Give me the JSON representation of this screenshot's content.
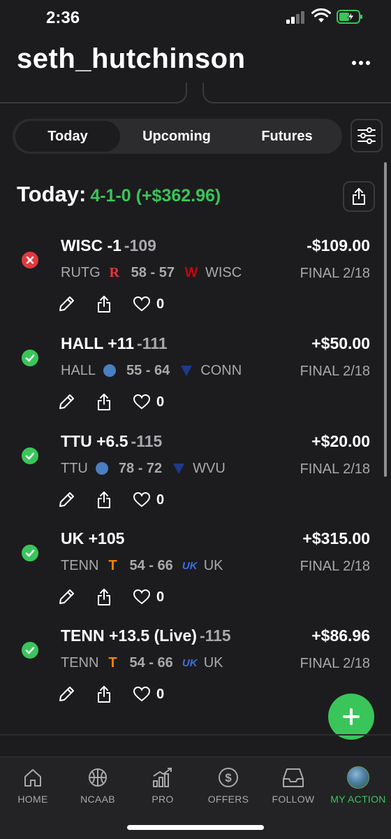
{
  "status": {
    "time": "2:36"
  },
  "header": {
    "username": "seth_hutchinson"
  },
  "tabs": [
    {
      "label": "Today",
      "active": true
    },
    {
      "label": "Upcoming",
      "active": false
    },
    {
      "label": "Futures",
      "active": false
    }
  ],
  "summary": {
    "label": "Today:",
    "record": "4-1-0 (+$362.96)"
  },
  "bets": [
    {
      "result": "loss",
      "pick": "WISC -1",
      "odds": "-109",
      "amount": "-$109.00",
      "away": "RUTG",
      "away_logo": "R",
      "score": "58 - 57",
      "home_logo": "W",
      "home": "WISC",
      "status": "FINAL 2/18",
      "likes": "0"
    },
    {
      "result": "win",
      "pick": "HALL +11",
      "odds": "-111",
      "amount": "+$50.00",
      "away": "HALL",
      "away_logo": "",
      "score": "55 - 64",
      "home_logo": "",
      "home": "CONN",
      "status": "FINAL 2/18",
      "likes": "0"
    },
    {
      "result": "win",
      "pick": "TTU +6.5",
      "odds": "-115",
      "amount": "+$20.00",
      "away": "TTU",
      "away_logo": "",
      "score": "78 - 72",
      "home_logo": "",
      "home": "WVU",
      "status": "FINAL 2/18",
      "likes": "0"
    },
    {
      "result": "win",
      "pick": "UK +105",
      "odds": "",
      "amount": "+$315.00",
      "away": "TENN",
      "away_logo": "T",
      "score": "54 - 66",
      "home_logo": "UK",
      "home": "UK",
      "status": "FINAL 2/18",
      "likes": "0"
    },
    {
      "result": "win",
      "pick": "TENN +13.5 (Live)",
      "odds": "-115",
      "amount": "+$86.96",
      "away": "TENN",
      "away_logo": "T",
      "score": "54 - 66",
      "home_logo": "UK",
      "home": "UK",
      "status": "FINAL 2/18",
      "likes": "0"
    }
  ],
  "nav": [
    {
      "label": "HOME",
      "icon": "home-icon"
    },
    {
      "label": "NCAAB",
      "icon": "basketball-icon"
    },
    {
      "label": "PRO",
      "icon": "chart-icon"
    },
    {
      "label": "OFFERS",
      "icon": "dollar-icon"
    },
    {
      "label": "FOLLOW",
      "icon": "inbox-icon"
    },
    {
      "label": "MY ACTION",
      "icon": "avatar",
      "active": true
    }
  ],
  "colors": {
    "background": "#1c1c1e",
    "win": "#3ac55a",
    "loss": "#e0393e",
    "muted": "#a8a8ad"
  }
}
